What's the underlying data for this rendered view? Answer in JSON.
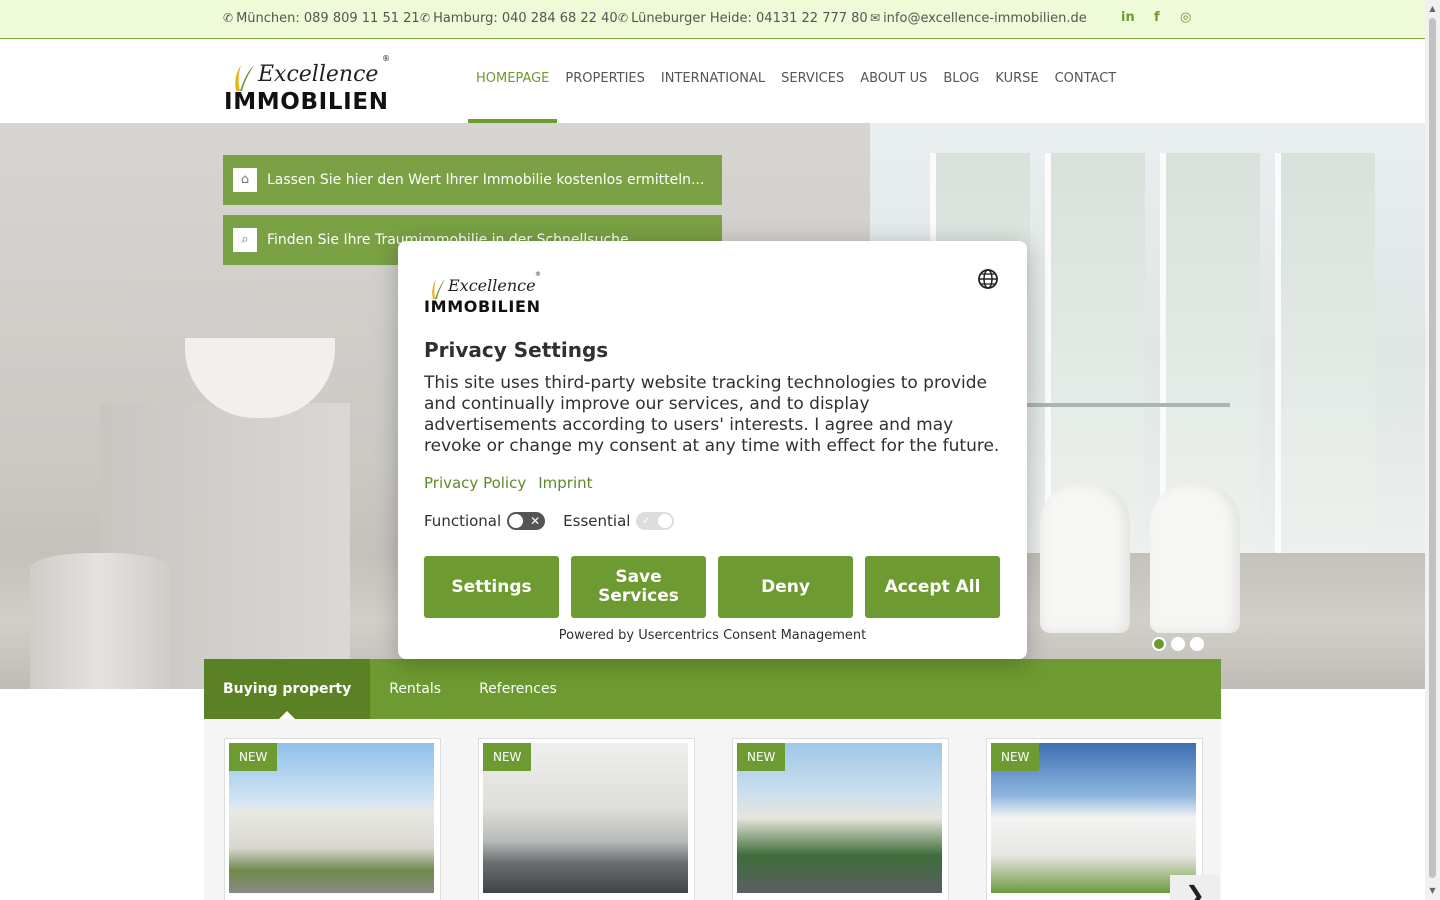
{
  "topbar": {
    "contacts": [
      {
        "icon": "phone-icon",
        "text": "München: 089 809 11 51 21"
      },
      {
        "icon": "phone-icon",
        "text": "Hamburg: 040 284 68 22 40"
      },
      {
        "icon": "phone-icon",
        "text": "Lüneburger Heide: 04131 22 777 80"
      },
      {
        "icon": "envelope-icon",
        "text": "info@excellence-immobilien.de"
      }
    ],
    "social": [
      "in",
      "f",
      "◎"
    ]
  },
  "logo": {
    "script": "Excellence",
    "word": "IMMOBILIEN",
    "mark": "®"
  },
  "nav": {
    "items": [
      "Homepage",
      "Properties",
      "International",
      "Services",
      "About us",
      "Blog",
      "Kurse",
      "Contact"
    ],
    "active": "Homepage"
  },
  "hero": {
    "promo_valuation": "Lassen Sie hier den Wert Ihrer Immobilie kostenlos ermitteln...",
    "promo_search": "Finden Sie Ihre Traumimmobilie in der Schnellsuche",
    "slides": 3,
    "active_slide": 1
  },
  "tabs": [
    "Buying property",
    "Rentals",
    "References"
  ],
  "active_tab": "Buying property",
  "listings": [
    {
      "badge": "NEW"
    },
    {
      "badge": "NEW"
    },
    {
      "badge": "NEW"
    },
    {
      "badge": "NEW"
    }
  ],
  "consent": {
    "title": "Privacy Settings",
    "text": "This site uses third-party website tracking technologies to provide and continually improve our services, and to display advertisements according to users' interests. I agree and may revoke or change my consent at any time with effect for the future.",
    "links": [
      "Privacy Policy",
      "Imprint"
    ],
    "toggle_functional": "Functional",
    "toggle_essential": "Essential",
    "buttons": [
      "Settings",
      "Save Services",
      "Deny",
      "Accept All"
    ],
    "powered_by": "Powered by Usercentrics Consent Management"
  },
  "colors": {
    "brand_green": "#6d9a31",
    "topbar_bg": "#eefad8"
  }
}
